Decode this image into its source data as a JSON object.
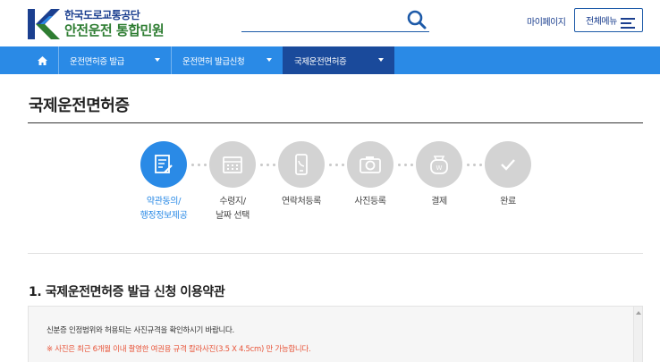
{
  "header": {
    "logo_top": "한국도로교통공단",
    "logo_bottom": "안전운전 통합민원",
    "search_placeholder": "",
    "mypage_label": "마이페이지",
    "allmenu_label": "전체메뉴"
  },
  "nav": {
    "items": [
      {
        "label": "운전면허증 발급"
      },
      {
        "label": "운전면허 발급신청"
      },
      {
        "label": "국제운전면허증"
      }
    ]
  },
  "main": {
    "title": "국제운전면허증",
    "steps": [
      {
        "line1": "약관동의/",
        "line2": "행정정보제공",
        "icon": "document-edit-icon"
      },
      {
        "line1": "수령지/",
        "line2": "날짜 선택",
        "icon": "calendar-icon"
      },
      {
        "line1": "연락처등록",
        "line2": "",
        "icon": "phone-icon"
      },
      {
        "line1": "사진등록",
        "line2": "",
        "icon": "camera-icon"
      },
      {
        "line1": "결제",
        "line2": "",
        "icon": "wallet-icon"
      },
      {
        "line1": "완료",
        "line2": "",
        "icon": "check-icon"
      }
    ],
    "section_title": "1. 국제운전면허증 발급 신청 이용약관",
    "terms": {
      "line1": "신분증 인정범위와 허용되는 사진규격을 확인하시기 바랍니다.",
      "line2": "※ 사진은 최근 6개월 이내 촬영한 여권용 규격 칼라사진(3.5 X 4.5cm) 만 가능합니다."
    }
  },
  "colors": {
    "nav_blue": "#2a8ae6",
    "nav_active": "#1a4a9b",
    "brand_navy": "#1b3f8f",
    "brand_green": "#2e7d32",
    "step_inactive": "#d3d3d3",
    "warning_text": "#e8553a"
  }
}
